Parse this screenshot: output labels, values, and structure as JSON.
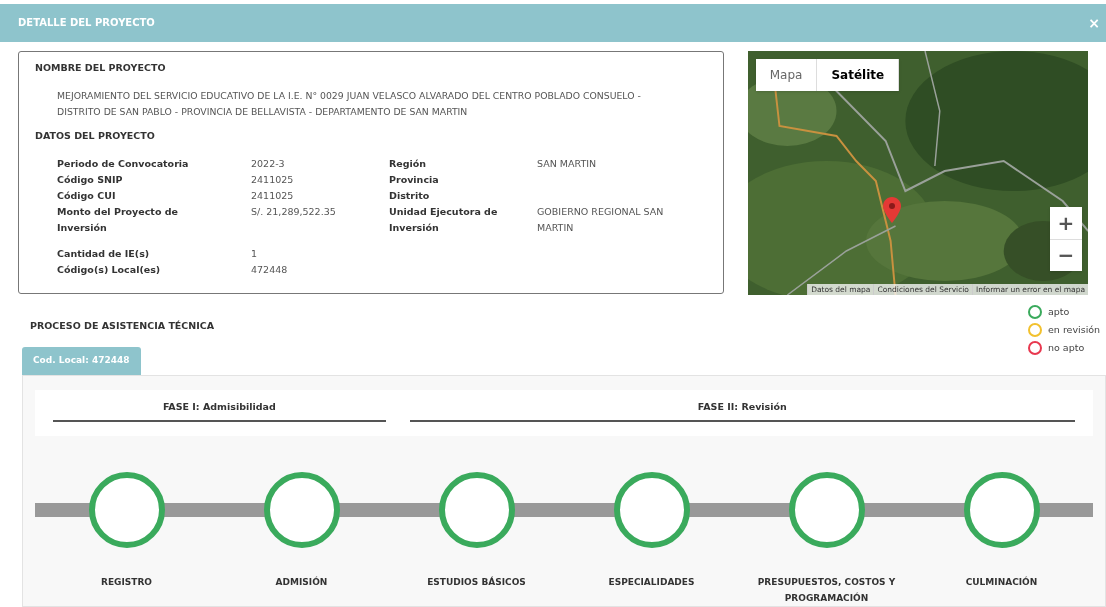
{
  "dialog": {
    "title": "DETALLE DEL PROYECTO",
    "close": "×"
  },
  "project": {
    "name_heading": "NOMBRE DEL PROYECTO",
    "name": "MEJORAMIENTO DEL SERVICIO EDUCATIVO DE LA I.E. N° 0029 JUAN VELASCO ALVARADO DEL CENTRO POBLADO CONSUELO - DISTRITO DE SAN PABLO - PROVINCIA DE BELLAVISTA - DEPARTAMENTO DE SAN MARTIN",
    "data_heading": "DATOS DEL PROYECTO",
    "left_fields": [
      {
        "label": "Periodo de Convocatoria",
        "value": "2022-3"
      },
      {
        "label": "Código SNIP",
        "value": "2411025"
      },
      {
        "label": "Código CUI",
        "value": "2411025"
      },
      {
        "label": "Monto del Proyecto de Inversión",
        "value": "S/. 21,289,522.35"
      }
    ],
    "right_fields": [
      {
        "label": "Región",
        "value": "SAN MARTIN"
      },
      {
        "label": "Provincia"
      },
      {
        "label": "Distrito"
      },
      {
        "label": "Unidad Ejecutora de Inversión",
        "value": "GOBIERNO REGIONAL SAN MARTIN"
      }
    ],
    "extra_fields": [
      {
        "label": "Cantidad de IE(s)",
        "value": "1"
      },
      {
        "label": "Código(s) Local(es)",
        "value": "472448"
      }
    ]
  },
  "map": {
    "types": [
      {
        "label": "Mapa",
        "selected": false
      },
      {
        "label": "Satélite",
        "selected": true
      }
    ],
    "zoom_in": "+",
    "zoom_out": "−",
    "footer": [
      "Datos del mapa",
      "Condiciones del Servicio",
      "Informar un error en el mapa"
    ]
  },
  "process": {
    "title": "PROCESO DE ASISTENCIA TÉCNICA",
    "legend": [
      {
        "label": "apto",
        "color": "#3aaa5c"
      },
      {
        "label": "en revisión",
        "color": "#f2c12e"
      },
      {
        "label": "no apto",
        "color": "#e8384f"
      }
    ],
    "tabs": [
      {
        "label": "Cod. Local: 472448",
        "selected": true
      }
    ],
    "phases": [
      {
        "label": "FASE I: Admisibilidad"
      },
      {
        "label": "FASE II: Revisión"
      }
    ],
    "stages": [
      {
        "label": "REGISTRO",
        "color": "#3aaa5c"
      },
      {
        "label": "ADMISIÓN",
        "color": "#3aaa5c"
      },
      {
        "label": "ESTUDIOS BÁSICOS",
        "color": "#3aaa5c"
      },
      {
        "label": "ESPECIALIDADES",
        "color": "#3aaa5c"
      },
      {
        "label": "PRESUPUESTOS, COSTOS Y PROGRAMACIÓN",
        "color": "#3aaa5c"
      },
      {
        "label": "CULMINACIÓN",
        "color": "#3aaa5c"
      }
    ]
  }
}
